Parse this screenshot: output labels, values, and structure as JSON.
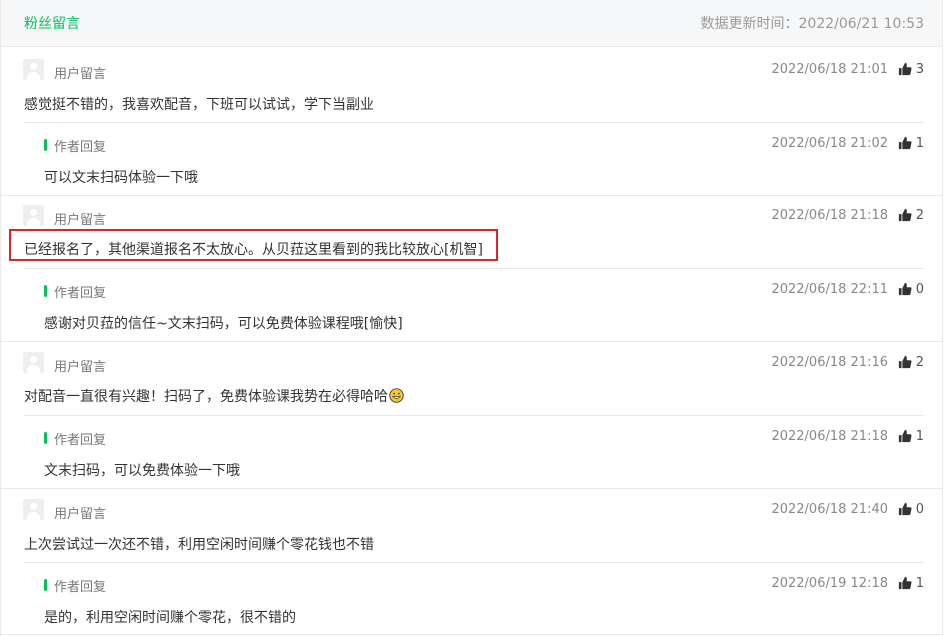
{
  "header": {
    "title": "粉丝留言",
    "updated": "数据更新时间：2022/06/21 10:53"
  },
  "threads": [
    {
      "comment": {
        "label": "用户留言",
        "time": "2022/06/18 21:01",
        "likes": "3",
        "text": "感觉挺不错的，我喜欢配音，下班可以试试，学下当副业"
      },
      "reply": {
        "label": "作者回复",
        "time": "2022/06/18 21:02",
        "likes": "1",
        "text": "可以文末扫码体验一下哦"
      }
    },
    {
      "comment": {
        "label": "用户留言",
        "time": "2022/06/18 21:18",
        "likes": "2",
        "text": "已经报名了，其他渠道报名不太放心。从贝菈这里看到的我比较放心[机智]"
      },
      "reply": {
        "label": "作者回复",
        "time": "2022/06/18 22:11",
        "likes": "0",
        "text": "感谢对贝菈的信任~文末扫码，可以免费体验课程哦[愉快]"
      }
    },
    {
      "comment": {
        "label": "用户留言",
        "time": "2022/06/18 21:16",
        "likes": "2",
        "text": "对配音一直很有兴趣！扫码了，免费体验课我势在必得哈哈"
      },
      "reply": {
        "label": "作者回复",
        "time": "2022/06/18 21:18",
        "likes": "1",
        "text": "文末扫码，可以免费体验一下哦"
      }
    },
    {
      "comment": {
        "label": "用户留言",
        "time": "2022/06/18 21:40",
        "likes": "0",
        "text": "上次尝试过一次还不错，利用空闲时间赚个零花钱也不错"
      },
      "reply": {
        "label": "作者回复",
        "time": "2022/06/19 12:18",
        "likes": "1",
        "text": "是的，利用空闲时间赚个零花，很不错的"
      }
    }
  ],
  "icons": {
    "like": "thumbs-up-icon",
    "avatar": "default-avatar-icon",
    "emoji": "grinning-emoji-icon"
  },
  "colors": {
    "accent": "#07c160",
    "highlight_box": "#d9262b"
  }
}
